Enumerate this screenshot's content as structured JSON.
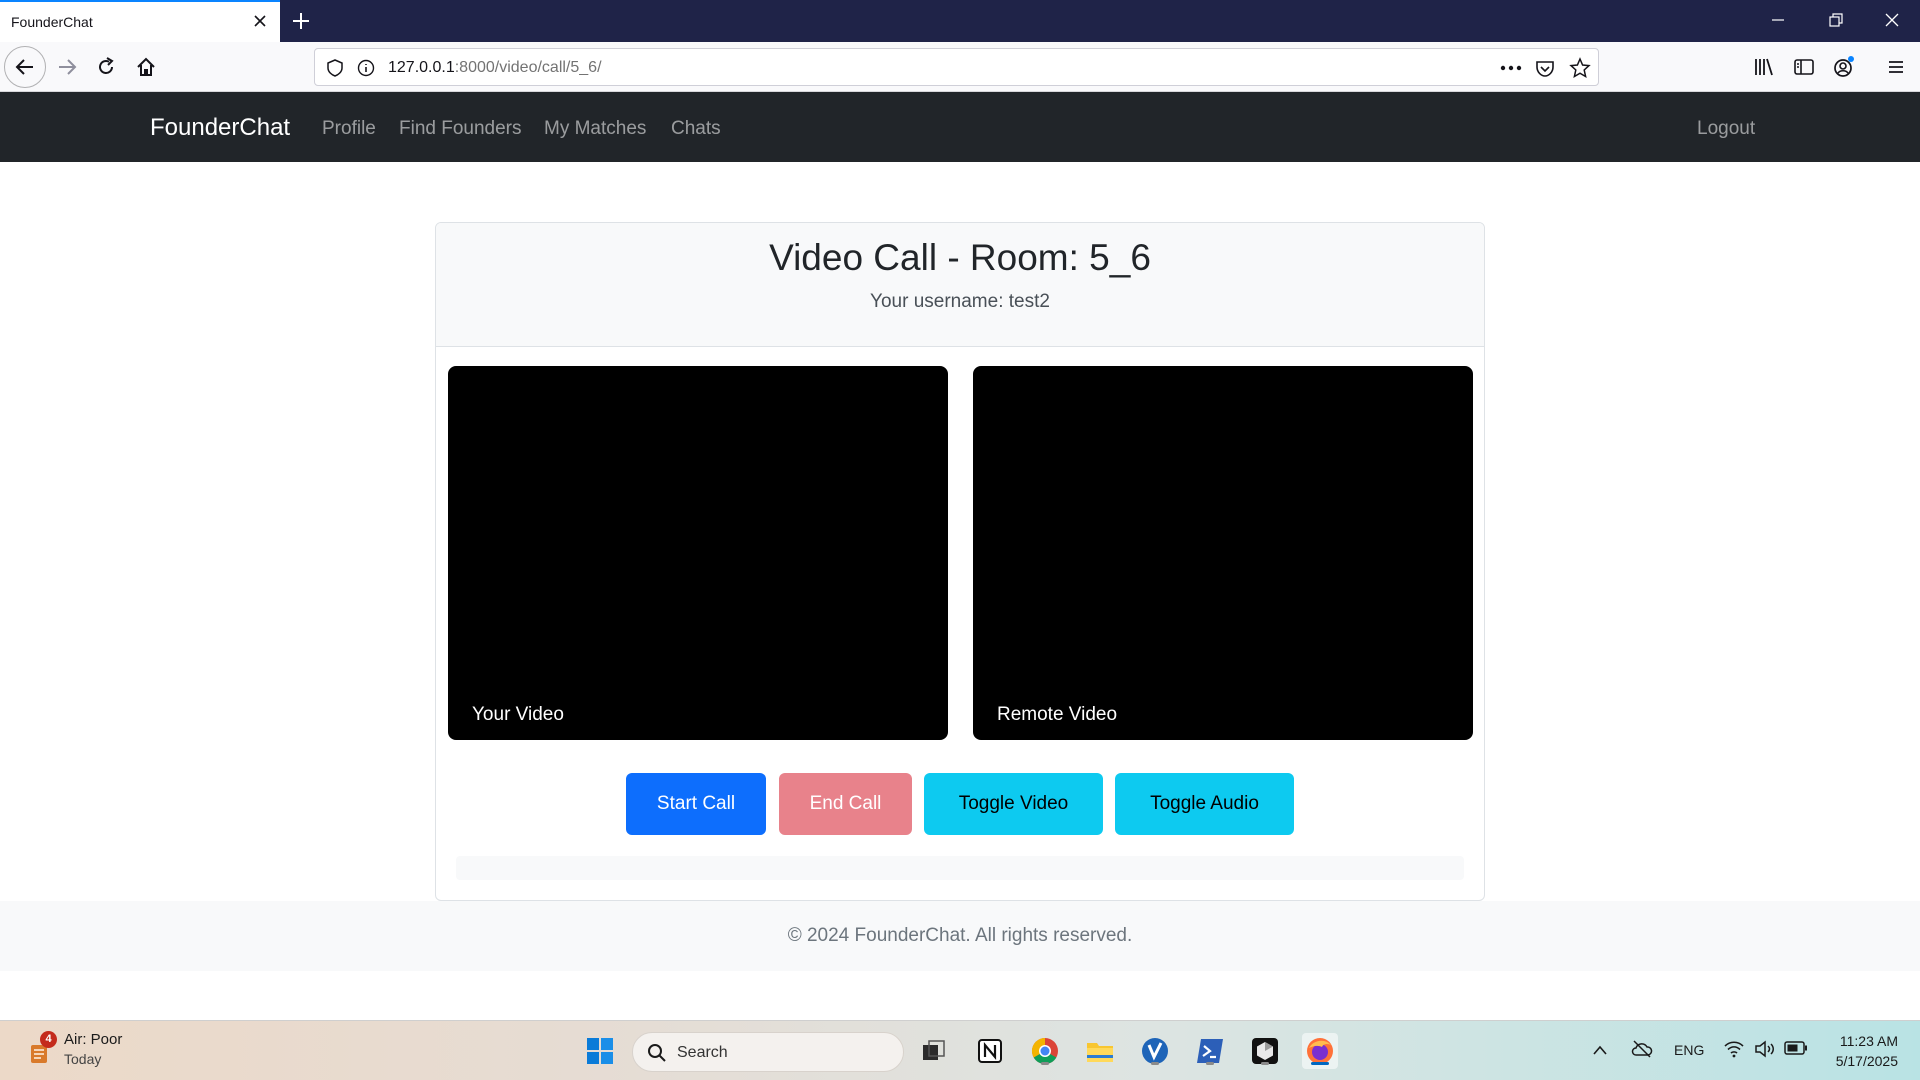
{
  "browser": {
    "tab_title": "FounderChat",
    "url_host": "127.0.0.1",
    "url_rest": ":8000/video/call/5_6/"
  },
  "site": {
    "brand": "FounderChat",
    "nav_links": [
      "Profile",
      "Find Founders",
      "My Matches",
      "Chats"
    ],
    "logout": "Logout"
  },
  "call": {
    "title": "Video Call - Room: 5_6",
    "username_line": "Your username: test2",
    "local_label": "Your Video",
    "remote_label": "Remote Video",
    "buttons": {
      "start": "Start Call",
      "end": "End Call",
      "toggle_video": "Toggle Video",
      "toggle_audio": "Toggle Audio"
    },
    "colors": {
      "start": "#0d6efd",
      "end": "#e8828b",
      "toggle": "#0dcaf0"
    }
  },
  "footer": {
    "text": "© 2024 FounderChat. All rights reserved."
  },
  "taskbar": {
    "weather_main": "Air: Poor",
    "weather_sub": "Today",
    "weather_badge": "4",
    "search_label": "Search",
    "lang": "ENG",
    "time": "11:23 AM",
    "date": "5/17/2025",
    "apps": [
      "task-view-icon",
      "notion-icon",
      "chrome-icon",
      "file-explorer-icon",
      "vscode-like-icon",
      "powershell-icon",
      "cursor-icon",
      "firefox-icon"
    ]
  }
}
